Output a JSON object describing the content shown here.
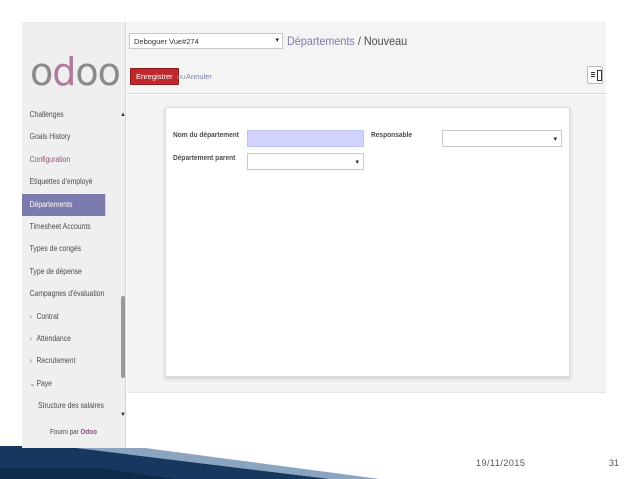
{
  "sidebar": {
    "logo": "odoo",
    "items": [
      {
        "label": "Challenges"
      },
      {
        "label": "Goals History"
      },
      {
        "label": "Configuration"
      },
      {
        "label": "Etiquettes d'employé"
      },
      {
        "label": "Départements"
      },
      {
        "label": "Timesheet Accounts"
      },
      {
        "label": "Types de congés"
      },
      {
        "label": "Type de dépense"
      },
      {
        "label": "Campagnes d'évaluation"
      },
      {
        "label": "Contrat"
      },
      {
        "label": "Attendance"
      },
      {
        "label": "Recrutement"
      },
      {
        "label": "Paye"
      },
      {
        "label": "Structure des salaires"
      }
    ],
    "powered_prefix": "Fourni par",
    "powered_brand": "Odoo"
  },
  "header": {
    "debug_select_value": "Deboguer Vue#274",
    "breadcrumb_parent": "Départements",
    "breadcrumb_separator": "/",
    "breadcrumb_current": "Nouveau",
    "save_label": "Enregistrer",
    "or_label": "ou",
    "cancel_label": "Annuler"
  },
  "form": {
    "name_label": "Nom du département",
    "name_value": "",
    "manager_label": "Responsable",
    "manager_value": "",
    "parent_label": "Département parent",
    "parent_value": ""
  },
  "slide_footer": {
    "date": "19/11/2015",
    "page": "31"
  },
  "colors": {
    "brand_purple": "#7c7bad",
    "save_red": "#c0282d",
    "required_field": "#d2d2ff",
    "section_plum": "#8c4f77"
  }
}
